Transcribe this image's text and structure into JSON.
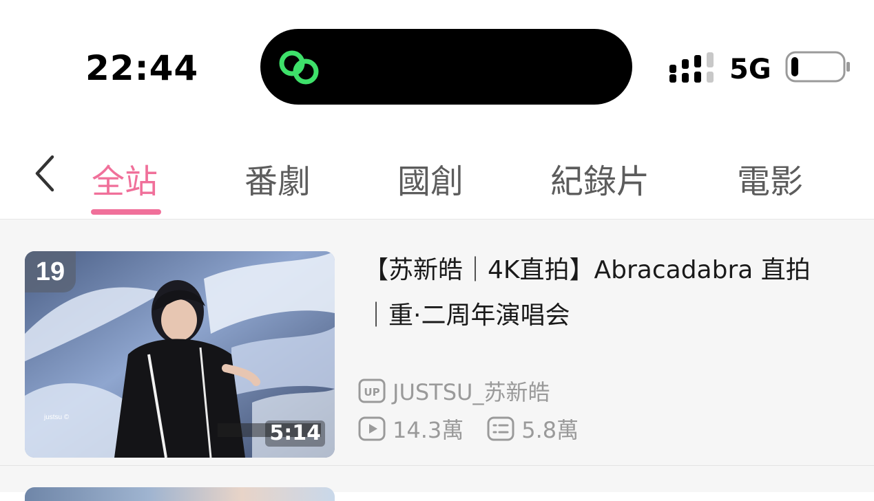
{
  "status_bar": {
    "time": "22:44",
    "network": "5G",
    "island_icon": "link-rings-icon",
    "signal_icon": "cellular-signal-icon",
    "battery_icon": "battery-low-icon"
  },
  "tabs": {
    "back_icon": "chevron-left-icon",
    "items": [
      {
        "label": "全站",
        "active": true
      },
      {
        "label": "番劇",
        "active": false
      },
      {
        "label": "國創",
        "active": false
      },
      {
        "label": "紀錄片",
        "active": false
      },
      {
        "label": "電影",
        "active": false
      }
    ],
    "accent_color": "#f0709a"
  },
  "video": {
    "rank": "19",
    "title_line1": "【苏新皓｜4K直拍】Abracadabra 直拍",
    "title_line2": "｜重·二周年演唱会",
    "duration": "5:14",
    "watermark": "justsu ©",
    "uploader": "JUSTSU_苏新皓",
    "views": "14.3萬",
    "danmaku": "5.8萬",
    "uploader_icon": "up-badge-icon",
    "views_icon": "play-icon",
    "danmaku_icon": "danmaku-icon"
  }
}
